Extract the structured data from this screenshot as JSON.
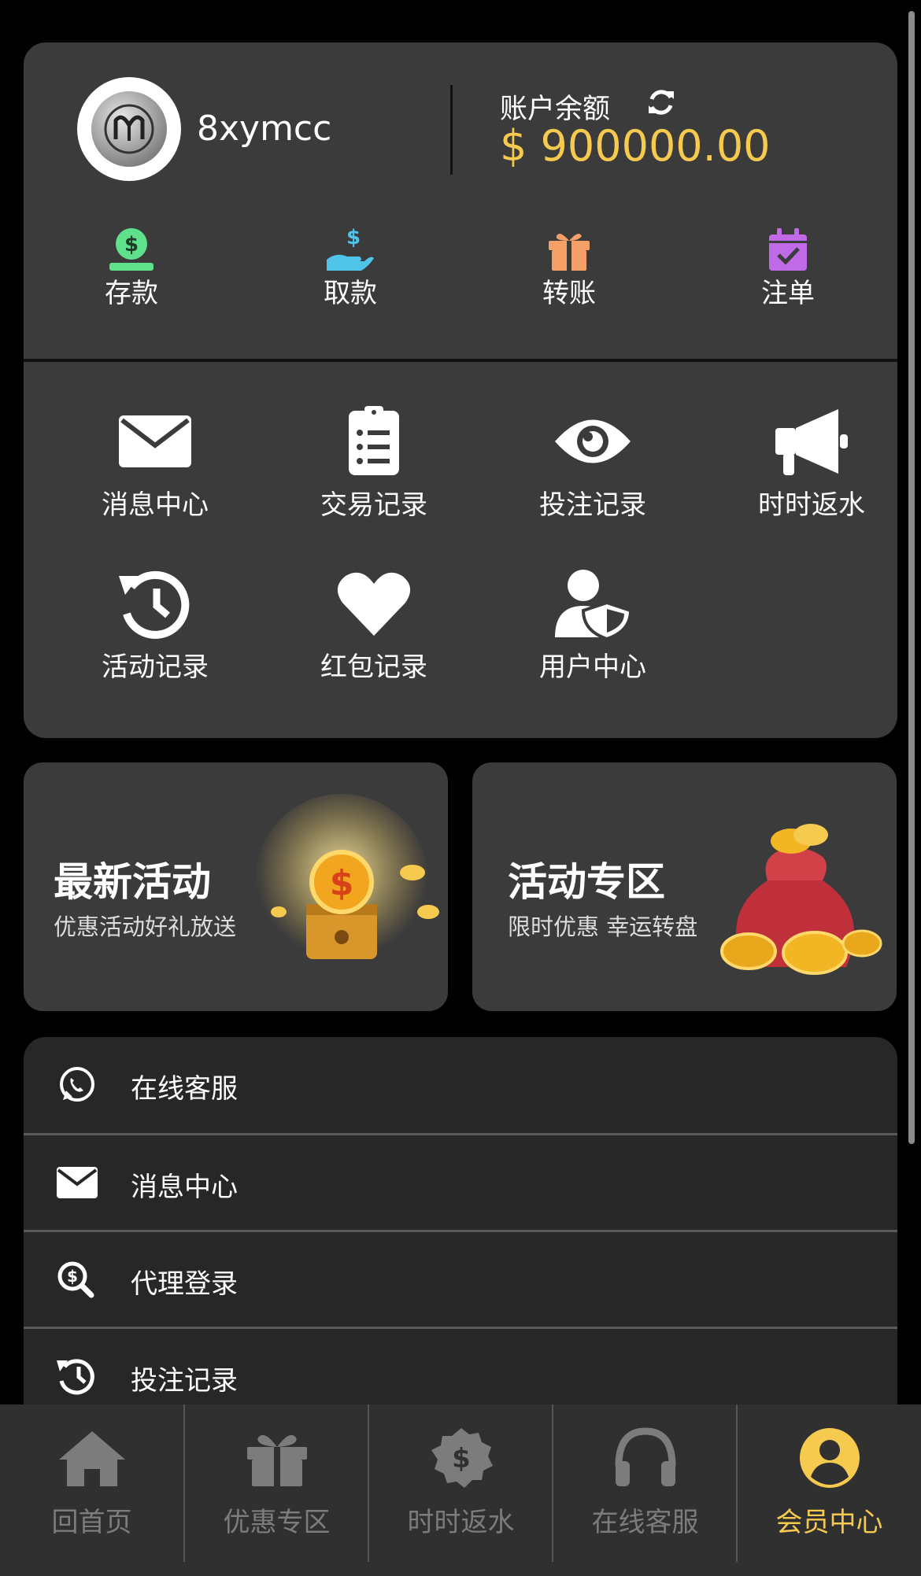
{
  "profile": {
    "username": "8xymcc",
    "balance_label": "账户余额",
    "balance_amount": "$ 900000.00"
  },
  "quick_actions": [
    {
      "label": "存款",
      "icon": "deposit-icon"
    },
    {
      "label": "取款",
      "icon": "withdraw-icon"
    },
    {
      "label": "转账",
      "icon": "gift-transfer-icon"
    },
    {
      "label": "注单",
      "icon": "calendar-check-icon"
    }
  ],
  "menu_grid": [
    {
      "label": "消息中心",
      "icon": "envelope-icon"
    },
    {
      "label": "交易记录",
      "icon": "clipboard-list-icon"
    },
    {
      "label": "投注记录",
      "icon": "eye-icon"
    },
    {
      "label": "时时返水",
      "icon": "megaphone-icon"
    },
    {
      "label": "活动记录",
      "icon": "history-icon"
    },
    {
      "label": "红包记录",
      "icon": "heart-icon"
    },
    {
      "label": "用户中心",
      "icon": "user-shield-icon"
    }
  ],
  "promos": [
    {
      "title": "最新活动",
      "subtitle": "优惠活动好礼放送"
    },
    {
      "title": "活动专区",
      "subtitle": "限时优惠 幸运转盘"
    }
  ],
  "list_items": [
    {
      "label": "在线客服",
      "icon": "whatsapp-icon"
    },
    {
      "label": "消息中心",
      "icon": "envelope-icon"
    },
    {
      "label": "代理登录",
      "icon": "search-dollar-icon"
    },
    {
      "label": "投注记录",
      "icon": "history-icon"
    }
  ],
  "tabs": [
    {
      "label": "回首页",
      "icon": "home-icon",
      "active": false
    },
    {
      "label": "优惠专区",
      "icon": "gift-icon",
      "active": false
    },
    {
      "label": "时时返水",
      "icon": "dollar-badge-icon",
      "active": false
    },
    {
      "label": "在线客服",
      "icon": "headphones-icon",
      "active": false
    },
    {
      "label": "会员中心",
      "icon": "user-circle-icon",
      "active": true
    }
  ],
  "colors": {
    "accent": "#f6c94f",
    "card_bg": "#3b3b3c",
    "list_bg": "#272727",
    "tab_bg": "#303030",
    "inactive_tab": "#7c7c7c"
  }
}
